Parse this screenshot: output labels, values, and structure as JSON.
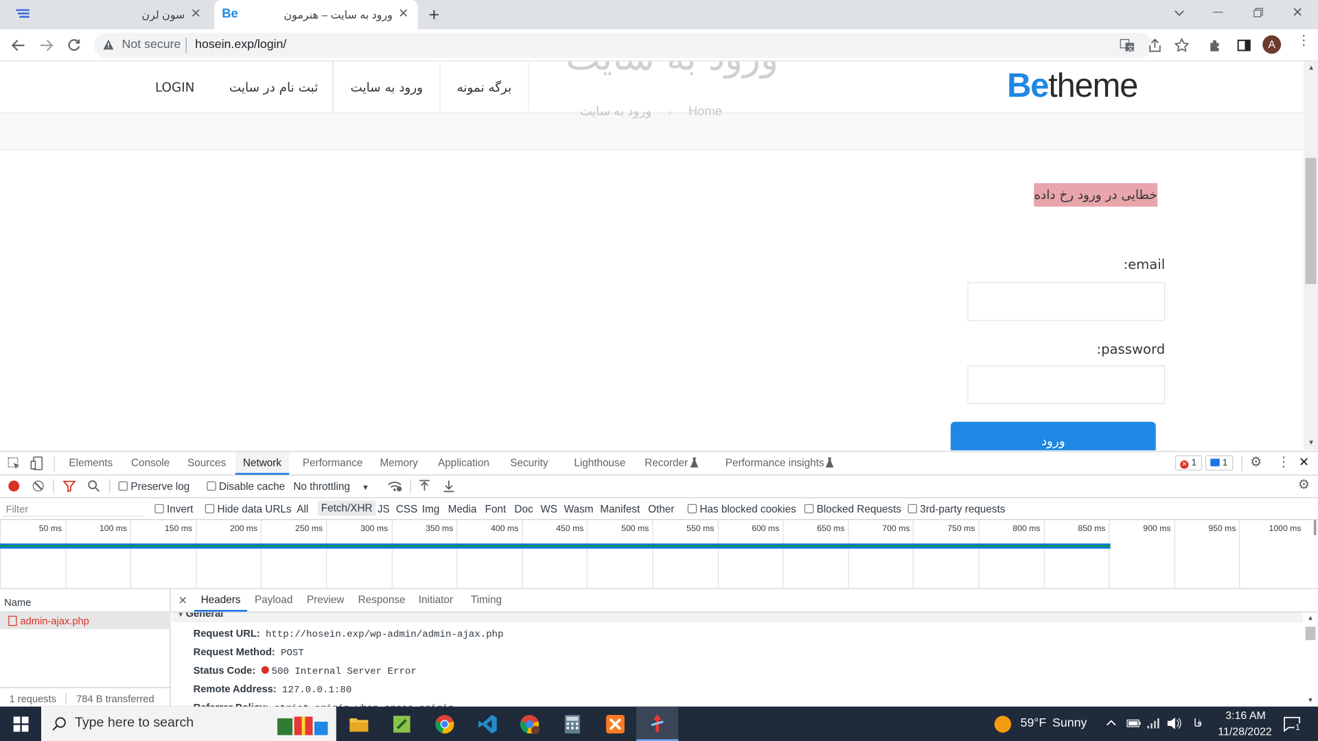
{
  "browser": {
    "tabs": [
      {
        "title": "سون لرن",
        "active": false
      },
      {
        "title": "ورود به سایت – هنرمون",
        "active": true
      }
    ],
    "security_label": "Not secure",
    "url": "hosein.exp/login/",
    "profile_initial": "A"
  },
  "site": {
    "logo_be": "Be",
    "logo_theme": "theme",
    "nav": [
      "LOGIN",
      "ثبت نام در سایت",
      "ورود به سایت",
      "برگه نمونه"
    ],
    "ghost_title": "ورود به سایت",
    "breadcrumb_home": "Home",
    "breadcrumb_current": "ورود به سایت",
    "error_message": "خطایی در ورود رخ داده",
    "email_label": ":email",
    "password_label": ":password",
    "submit_label": "ورود"
  },
  "devtools": {
    "tabs": [
      "Elements",
      "Console",
      "Sources",
      "Network",
      "Performance",
      "Memory",
      "Application",
      "Security",
      "Lighthouse",
      "Recorder",
      "Performance insights"
    ],
    "active_tab": "Network",
    "error_count": "1",
    "message_count": "1",
    "preserve_log": "Preserve log",
    "disable_cache": "Disable cache",
    "throttling": "No throttling",
    "filter_placeholder": "Filter",
    "invert": "Invert",
    "hide_data_urls": "Hide data URLs",
    "type_filters": [
      "All",
      "Fetch/XHR",
      "JS",
      "CSS",
      "Img",
      "Media",
      "Font",
      "Doc",
      "WS",
      "Wasm",
      "Manifest",
      "Other"
    ],
    "active_filter": "Fetch/XHR",
    "has_blocked_cookies": "Has blocked cookies",
    "blocked_requests": "Blocked Requests",
    "third_party": "3rd-party requests",
    "timeline_ticks": [
      "50 ms",
      "100 ms",
      "150 ms",
      "200 ms",
      "250 ms",
      "300 ms",
      "350 ms",
      "400 ms",
      "450 ms",
      "500 ms",
      "550 ms",
      "600 ms",
      "650 ms",
      "700 ms",
      "750 ms",
      "800 ms",
      "850 ms",
      "900 ms",
      "950 ms",
      "1000 ms"
    ],
    "timeline_request_ms": 850,
    "name_header": "Name",
    "requests": [
      {
        "name": "admin-ajax.php",
        "error": true
      }
    ],
    "summary_requests": "1 requests",
    "summary_transferred": "784 B transferred",
    "detail_tabs": [
      "Headers",
      "Payload",
      "Preview",
      "Response",
      "Initiator",
      "Timing"
    ],
    "active_detail_tab": "Headers",
    "section_title": "General",
    "general": [
      {
        "key": "Request URL:",
        "value": "http://hosein.exp/wp-admin/admin-ajax.php"
      },
      {
        "key": "Request Method:",
        "value": "POST"
      },
      {
        "key": "Status Code:",
        "value": "500 Internal Server Error"
      },
      {
        "key": "Remote Address:",
        "value": "127.0.0.1:80"
      },
      {
        "key": "Referrer Policy:",
        "value": "strict-origin-when-cross-origin"
      }
    ]
  },
  "taskbar": {
    "search_placeholder": "Type here to search",
    "weather_temp": "59°F",
    "weather_desc": "Sunny",
    "language": "فا",
    "time": "3:16 AM",
    "date": "11/28/2022",
    "notification_count": "1"
  },
  "colors": {
    "brand_blue": "#1e88e5",
    "error_bg": "#e8a5ab",
    "error_red": "#d93025",
    "taskbar": "#1f2a3a"
  }
}
